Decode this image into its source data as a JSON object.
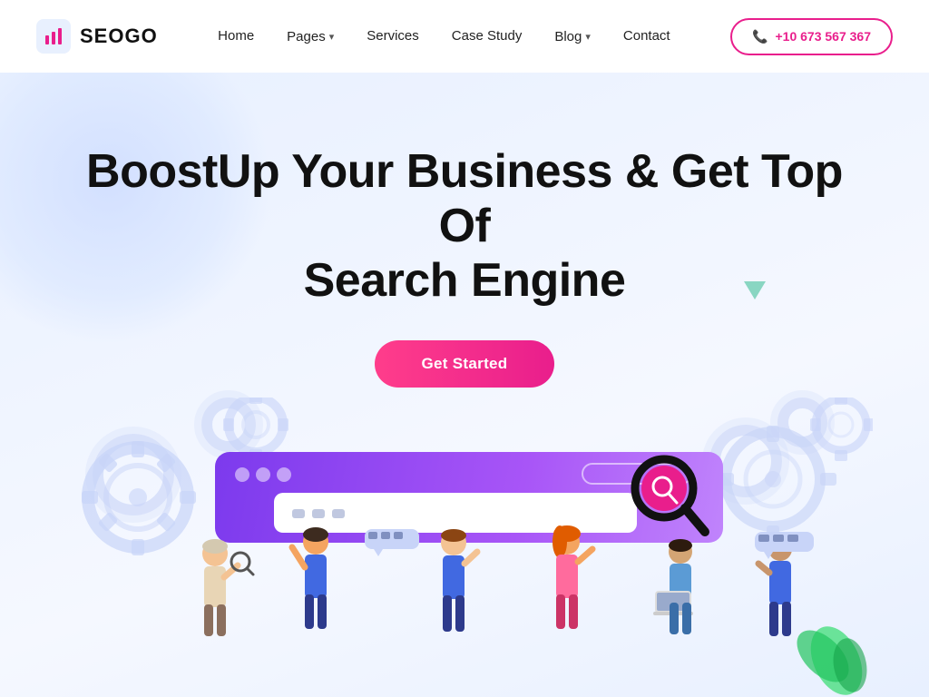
{
  "logo": {
    "text": "SEOGO"
  },
  "nav": {
    "home": "Home",
    "pages": "Pages",
    "services": "Services",
    "case_study": "Case Study",
    "blog": "Blog",
    "contact": "Contact",
    "phone": "+10 673 567 367"
  },
  "hero": {
    "title_line1": "BoostUp Your Business & Get Top Of",
    "title_line2": "Search Engine",
    "cta_button": "Get Started"
  }
}
